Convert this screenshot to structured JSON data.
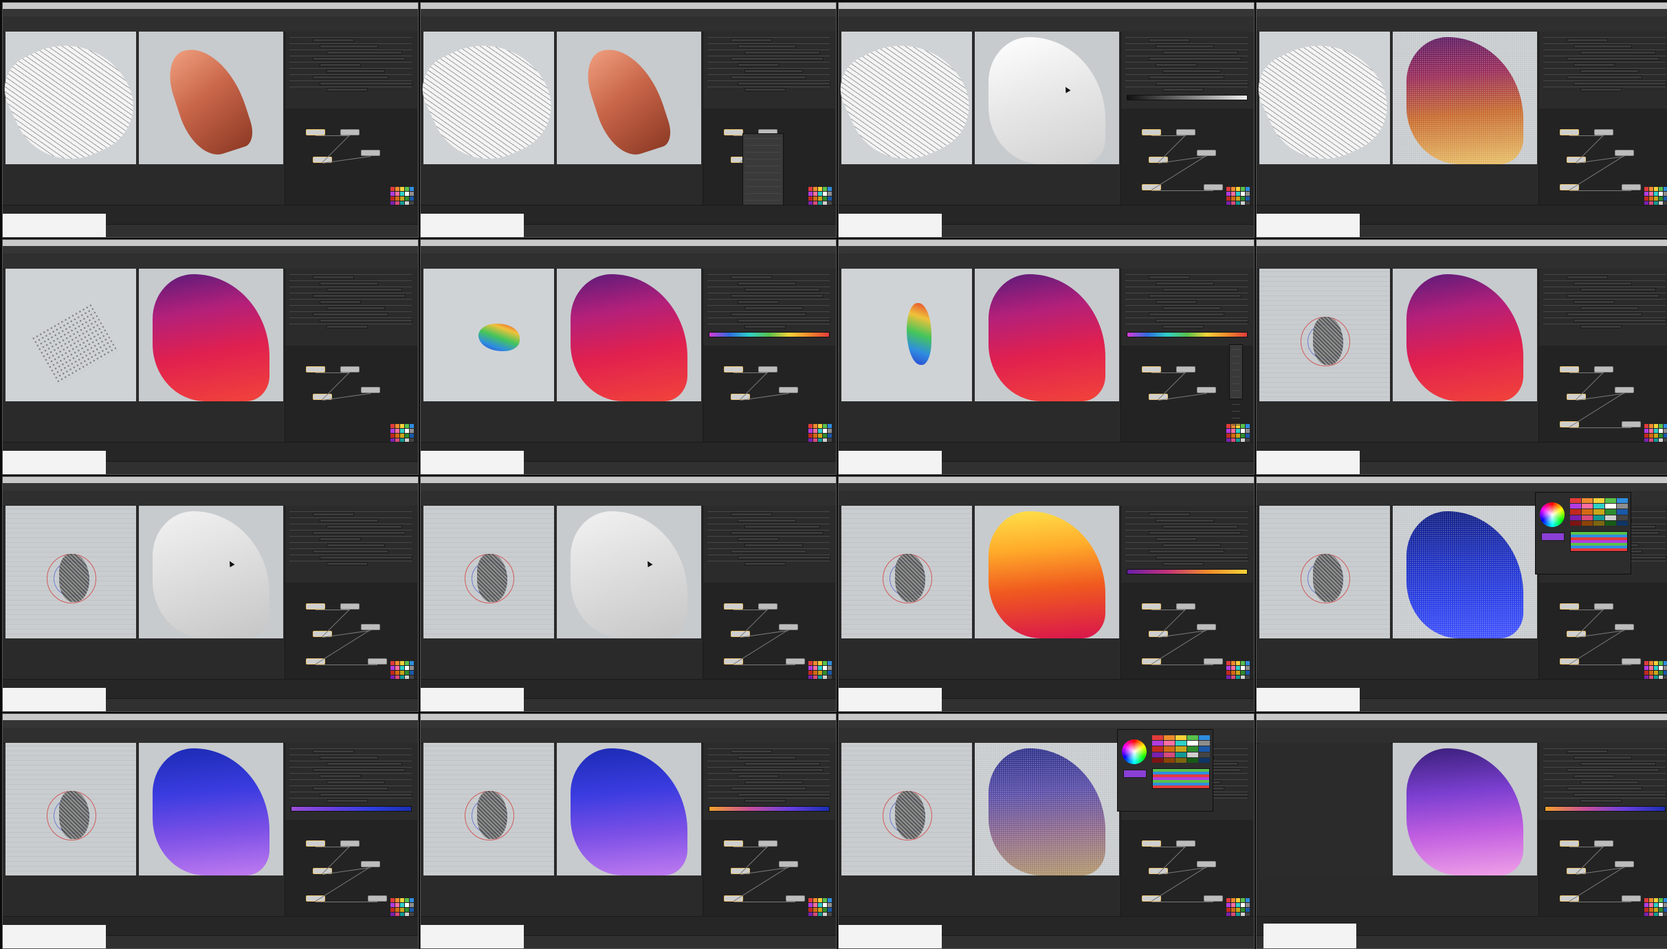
{
  "grid": {
    "rows": 4,
    "columns": 4
  },
  "frames": [
    {
      "id": "f1",
      "render": "terracotta",
      "left": "wire-grey",
      "palette": true,
      "nodes": 4,
      "extra": "none"
    },
    {
      "id": "f2",
      "render": "terracotta",
      "left": "wire-grey",
      "palette": true,
      "nodes": 3,
      "extra": "context-menu"
    },
    {
      "id": "f3",
      "render": "white-depth",
      "left": "wire-grey",
      "palette": true,
      "nodes": 6,
      "extra": "gradient-params"
    },
    {
      "id": "f4",
      "render": "gold-purple-noise",
      "left": "wire-grey",
      "palette": true,
      "nodes": 6,
      "extra": "none"
    },
    {
      "id": "f5",
      "render": "magenta-red",
      "left": "scatter-grey",
      "palette": true,
      "nodes": 4,
      "extra": "none"
    },
    {
      "id": "f6",
      "render": "magenta-red",
      "left": "heatmap-small",
      "palette": true,
      "nodes": 4,
      "extra": "spectrum-ramp"
    },
    {
      "id": "f7",
      "render": "magenta-red",
      "left": "heatmap-large",
      "palette": true,
      "nodes": 4,
      "extra": "spectrum-ramp-menu"
    },
    {
      "id": "f8",
      "render": "magenta-red",
      "left": "gizmo-grid",
      "palette": true,
      "nodes": 6,
      "extra": "none"
    },
    {
      "id": "f9",
      "render": "grey-depth",
      "left": "gizmo-grid",
      "palette": true,
      "nodes": 6,
      "extra": "none"
    },
    {
      "id": "f10",
      "render": "grey-depth",
      "left": "gizmo-grid",
      "palette": true,
      "nodes": 6,
      "extra": "none"
    },
    {
      "id": "f11",
      "render": "orange-red",
      "left": "gizmo-grid",
      "palette": true,
      "nodes": 6,
      "extra": "purple-orange-ramp"
    },
    {
      "id": "f12",
      "render": "blue-noise",
      "left": "gizmo-grid",
      "palette": true,
      "nodes": 6,
      "extra": "color-picker"
    },
    {
      "id": "f13",
      "render": "blue-purple",
      "left": "gizmo-grid",
      "palette": true,
      "nodes": 6,
      "extra": "purple-blue-ramp"
    },
    {
      "id": "f14",
      "render": "blue-purple",
      "left": "gizmo-grid",
      "palette": true,
      "nodes": 6,
      "extra": "orange-blue-ramp"
    },
    {
      "id": "f15",
      "render": "blue-purple-noise",
      "left": "gizmo-grid",
      "palette": true,
      "nodes": 6,
      "extra": "color-picker"
    },
    {
      "id": "f16",
      "render": "pink-purple",
      "left": "dark-empty",
      "palette": true,
      "nodes": 6,
      "extra": "orange-blue-ramp"
    }
  ],
  "colors": {
    "background": "#0b0b0b",
    "panel": "#2a2a2a",
    "viewport_left": "#cfd3d6",
    "viewport_right": "#c7cbce",
    "node_border": "#e9c36e",
    "palette": [
      "#e23b3b",
      "#f08b2c",
      "#f6d23a",
      "#59c14b",
      "#2f8de0",
      "#b23be2",
      "#ff6fa1",
      "#2fd0c7",
      "#ffffff",
      "#8e8e8e",
      "#c2281f",
      "#d46a12",
      "#c8a61b",
      "#2e8b2e",
      "#1a58a8",
      "#7b1fb0",
      "#d84a7c",
      "#129a93",
      "#cfcfcf",
      "#444444",
      "#7d1414",
      "#8c4308",
      "#7c6610",
      "#175a17",
      "#0f3566"
    ]
  },
  "icons": {
    "window": "window-icon",
    "cursor": "mouse-cursor-icon"
  }
}
